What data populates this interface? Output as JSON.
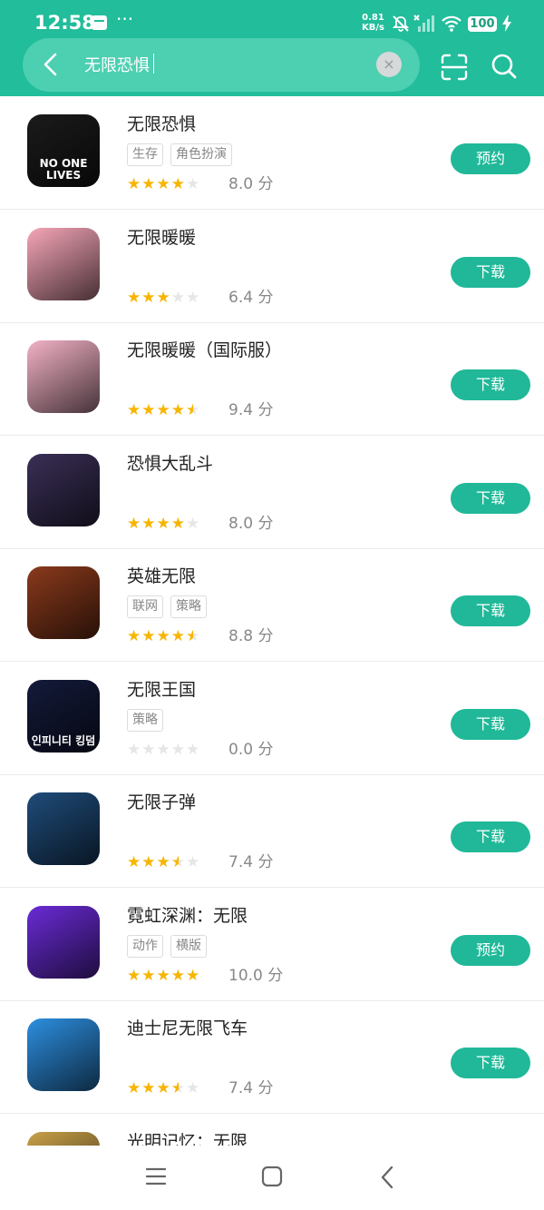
{
  "status_bar": {
    "time": "12:58",
    "more": "···",
    "speed_value": "0.81",
    "speed_unit": "KB/s",
    "battery": "100"
  },
  "search": {
    "query": "无限恐惧",
    "clear": "×"
  },
  "results": [
    {
      "name": "无限恐惧",
      "tags": [
        "生存",
        "角色扮演"
      ],
      "rating": 4,
      "score": "8.0 分",
      "action": "预约",
      "icon_bg": "#1b1b1b",
      "icon_text": "NO ONE LIVES"
    },
    {
      "name": "无限暖暖",
      "tags": [],
      "rating": 3,
      "score": "6.4 分",
      "action": "下载",
      "icon_bg": "#f6a6b8",
      "icon_text": ""
    },
    {
      "name": "无限暖暖（国际服）",
      "tags": [],
      "rating": 4.5,
      "score": "9.4 分",
      "action": "下载",
      "icon_bg": "#f3b2c6",
      "icon_text": ""
    },
    {
      "name": "恐惧大乱斗",
      "tags": [],
      "rating": 4,
      "score": "8.0 分",
      "action": "下载",
      "icon_bg": "#3a2f56",
      "icon_text": ""
    },
    {
      "name": "英雄无限",
      "tags": [
        "联网",
        "策略"
      ],
      "rating": 4.5,
      "score": "8.8 分",
      "action": "下载",
      "icon_bg": "#8a3a1c",
      "icon_text": ""
    },
    {
      "name": "无限王国",
      "tags": [
        "策略"
      ],
      "rating": 0,
      "score": "0.0 分",
      "action": "下载",
      "icon_bg": "#141a3a",
      "icon_text": "인피니티 킹덤"
    },
    {
      "name": "无限子弹",
      "tags": [],
      "rating": 3.5,
      "score": "7.4 分",
      "action": "下载",
      "icon_bg": "#1f4c7a",
      "icon_text": ""
    },
    {
      "name": "霓虹深渊：无限",
      "tags": [
        "动作",
        "横版"
      ],
      "rating": 5,
      "score": "10.0 分",
      "action": "预约",
      "icon_bg": "#6a2bd6",
      "icon_text": ""
    },
    {
      "name": "迪士尼无限飞车",
      "tags": [],
      "rating": 3.5,
      "score": "7.4 分",
      "action": "下载",
      "icon_bg": "#2d8fe0",
      "icon_text": ""
    },
    {
      "name": "光明记忆：无限",
      "tags": [],
      "rating": 0,
      "score": "",
      "action": "",
      "icon_bg": "#c9a14a",
      "icon_text": ""
    }
  ],
  "colors": {
    "brand": "#22bd9b",
    "button": "#20b898",
    "star": "#f7b500"
  }
}
